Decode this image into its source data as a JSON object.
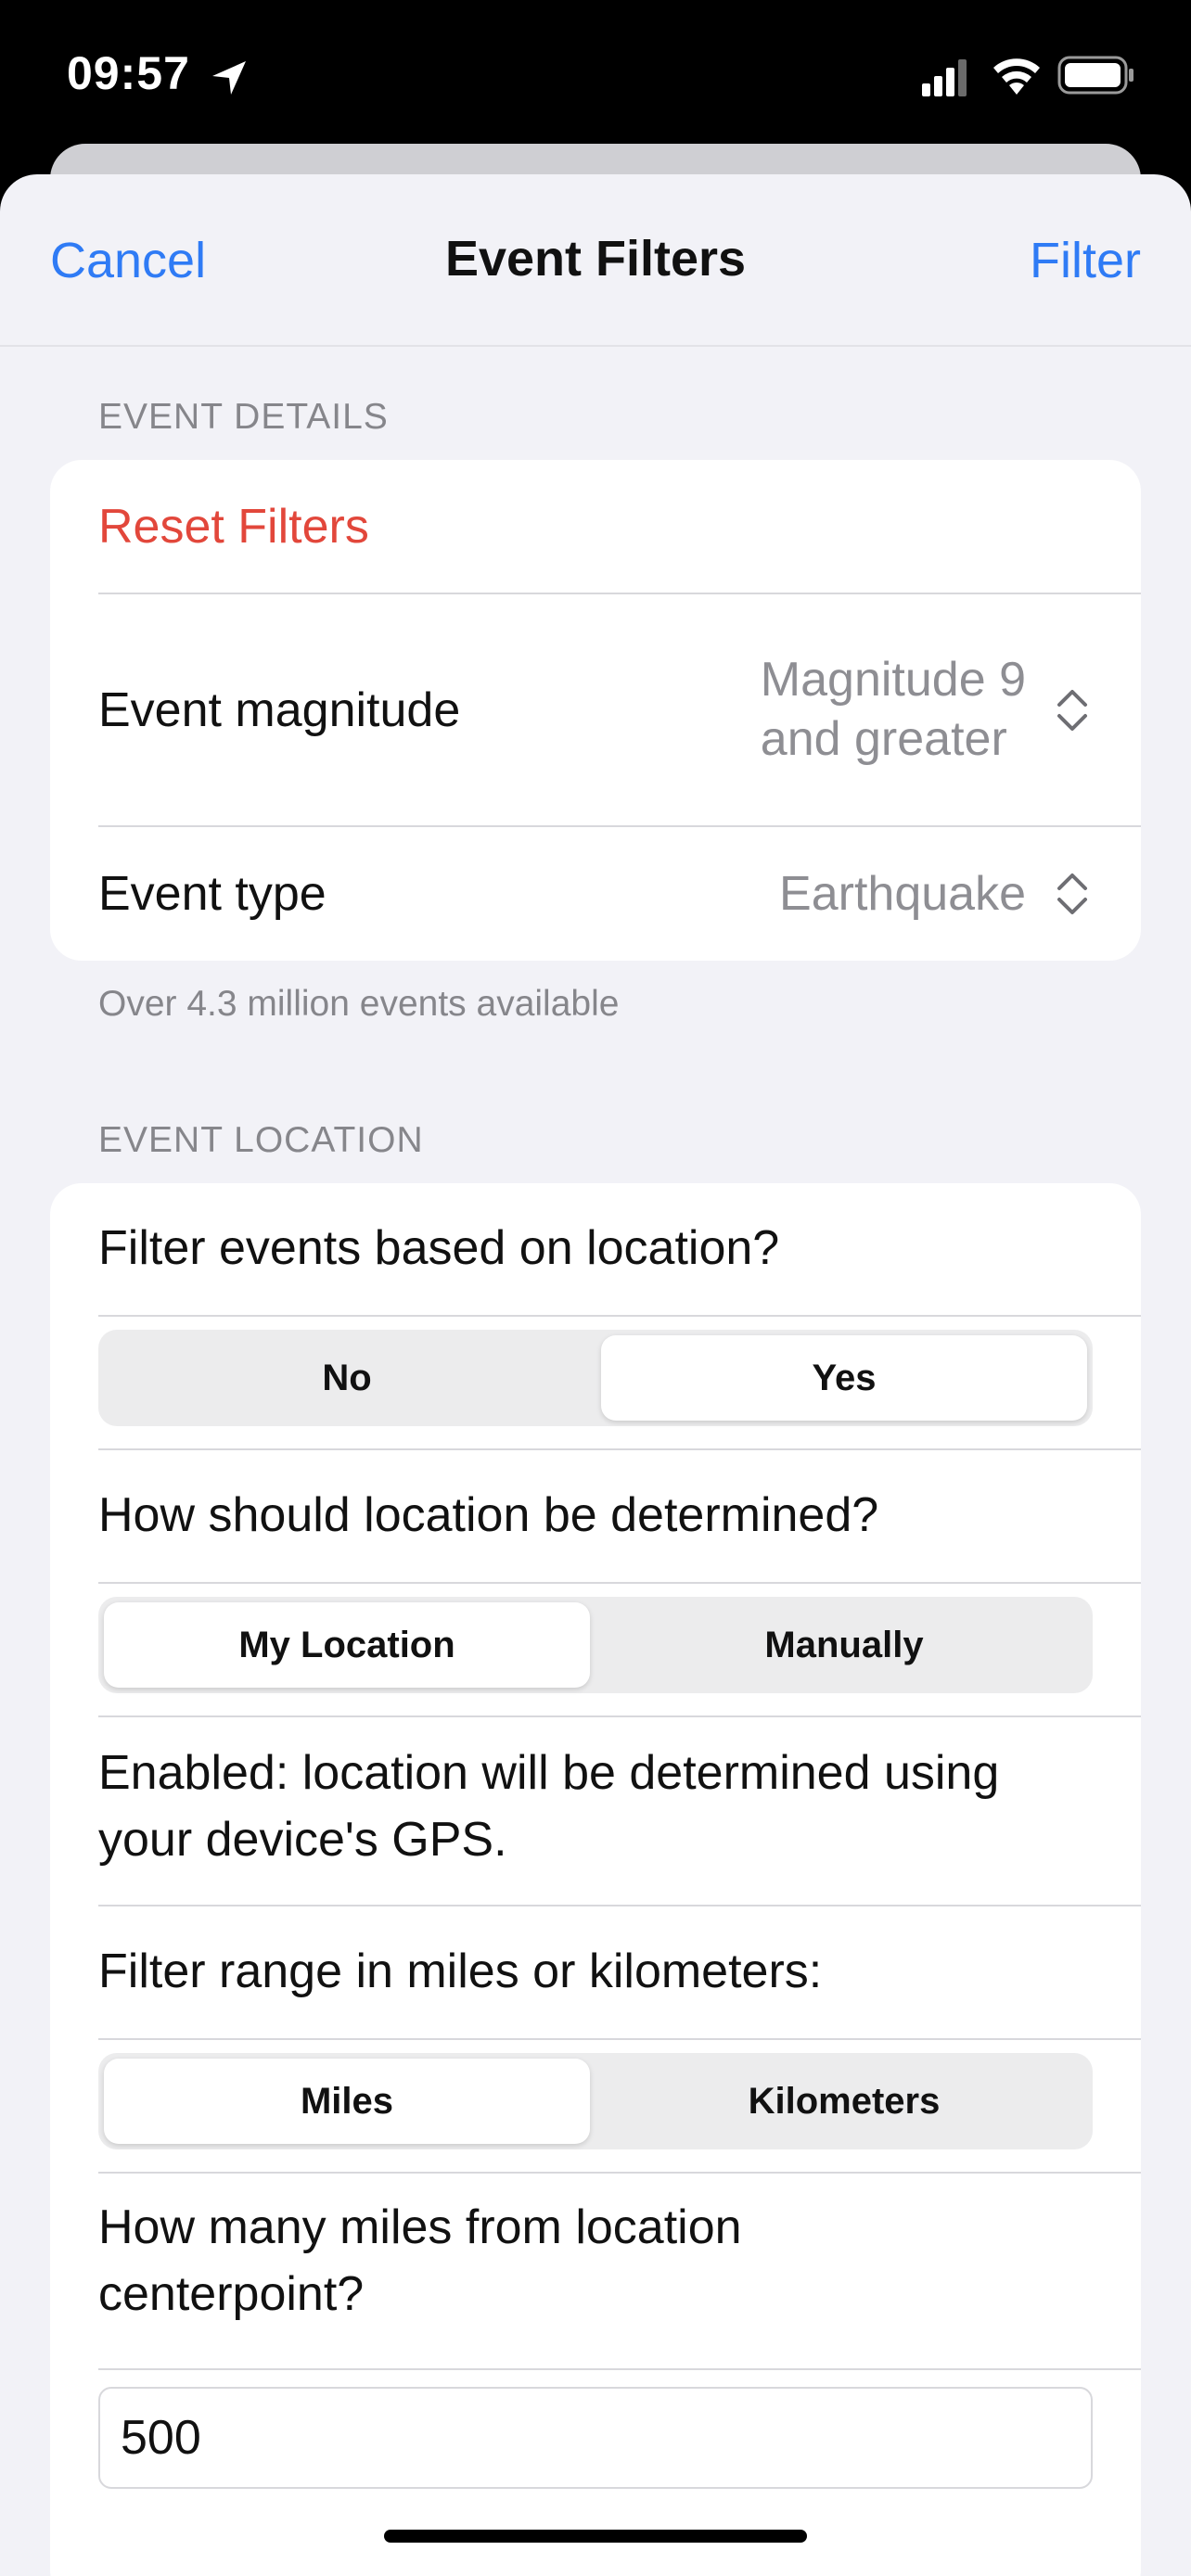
{
  "status_bar": {
    "time": "09:57"
  },
  "nav": {
    "cancel": "Cancel",
    "title": "Event Filters",
    "filter": "Filter"
  },
  "details": {
    "header": "EVENT DETAILS",
    "reset": "Reset Filters",
    "magnitude_label": "Event magnitude",
    "magnitude_value_line1": "Magnitude 9",
    "magnitude_value_line2": "and greater",
    "type_label": "Event type",
    "type_value": "Earthquake",
    "footer": "Over 4.3 million events available"
  },
  "location": {
    "header": "EVENT LOCATION",
    "filter_question": "Filter events based on location?",
    "filter_options": [
      "No",
      "Yes"
    ],
    "filter_selected": "Yes",
    "method_question": "How should location be determined?",
    "method_options": [
      "My Location",
      "Manually"
    ],
    "method_selected": "My Location",
    "enabled_line1": "Enabled: location will be determined using",
    "enabled_line2": "your device's GPS.",
    "range_question": "Filter range in miles or kilometers:",
    "range_options": [
      "Miles",
      "Kilometers"
    ],
    "range_selected": "Miles",
    "distance_question_line1": "How many miles from location",
    "distance_question_line2": "centerpoint?",
    "distance_value": "500"
  }
}
